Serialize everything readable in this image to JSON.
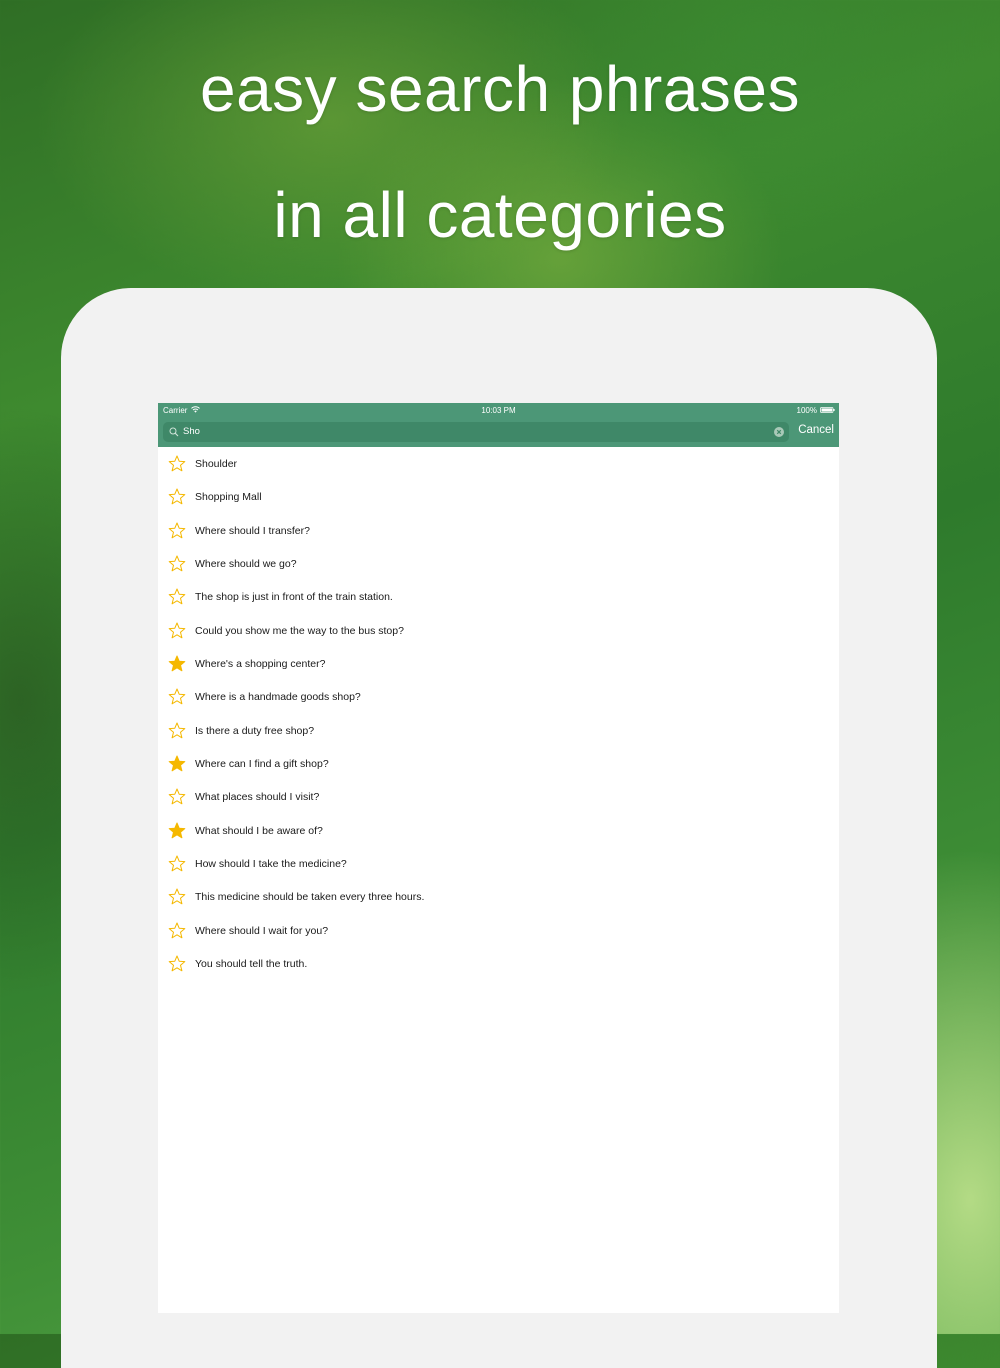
{
  "headline": {
    "line1": "easy search phrases",
    "line2": "in all categories"
  },
  "status_bar": {
    "carrier": "Carrier",
    "time": "10:03 PM",
    "battery": "100%"
  },
  "search": {
    "value": "Sho",
    "cancel_label": "Cancel"
  },
  "colors": {
    "nav_bar": "#4c9777",
    "search_field": "#3f8868",
    "star": "#f5b800"
  },
  "results": [
    {
      "label": "Shoulder",
      "starred": false
    },
    {
      "label": "Shopping Mall",
      "starred": false
    },
    {
      "label": "Where should I transfer?",
      "starred": false
    },
    {
      "label": "Where should we go?",
      "starred": false
    },
    {
      "label": "The shop is just in front of the train station.",
      "starred": false
    },
    {
      "label": "Could you show me the way to the bus stop?",
      "starred": false
    },
    {
      "label": "Where's a shopping center?",
      "starred": true
    },
    {
      "label": "Where is a handmade goods shop?",
      "starred": false
    },
    {
      "label": "Is there a duty free shop?",
      "starred": false
    },
    {
      "label": "Where can I find a gift shop?",
      "starred": true
    },
    {
      "label": "What places should I visit?",
      "starred": false
    },
    {
      "label": "What should I be aware of?",
      "starred": true
    },
    {
      "label": "How should I take the medicine?",
      "starred": false
    },
    {
      "label": "This medicine should be taken every three hours.",
      "starred": false
    },
    {
      "label": "Where should I wait for you?",
      "starred": false
    },
    {
      "label": "You should tell the truth.",
      "starred": false
    }
  ]
}
